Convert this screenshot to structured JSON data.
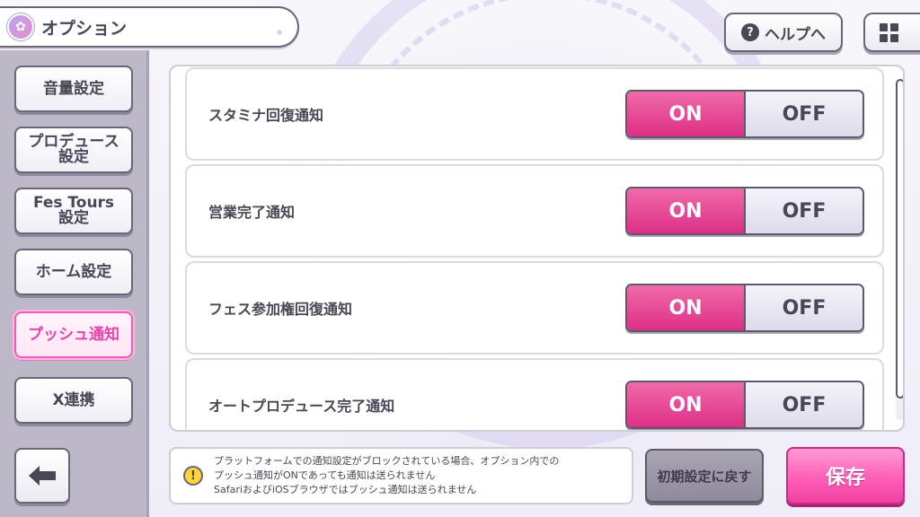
{
  "header": {
    "title": "オプション",
    "help_label": "ヘルプへ"
  },
  "sidebar": {
    "items": [
      {
        "label": "音量設定",
        "active": false
      },
      {
        "label": "プロデュース\n設定",
        "active": false
      },
      {
        "label": "Fes Tours\n設定",
        "active": false
      },
      {
        "label": "ホーム設定",
        "active": false
      },
      {
        "label": "プッシュ通知",
        "active": true
      },
      {
        "label": "X連携",
        "active": false
      }
    ]
  },
  "settings": [
    {
      "label": "スタミナ回復通知",
      "on": "ON",
      "off": "OFF",
      "value": "ON"
    },
    {
      "label": "営業完了通知",
      "on": "ON",
      "off": "OFF",
      "value": "ON"
    },
    {
      "label": "フェス参加権回復通知",
      "on": "ON",
      "off": "OFF",
      "value": "ON"
    },
    {
      "label": "オートプロデュース完了通知",
      "on": "ON",
      "off": "OFF",
      "value": "ON"
    }
  ],
  "notice": {
    "lines": [
      "プラットフォームでの通知設定がブロックされている場合、オプション内での",
      "プッシュ通知がONであっても通知は送られません",
      "SafariおよびiOSブラウザではプッシュ通知は送られません"
    ]
  },
  "actions": {
    "reset_label": "初期設定に戻す",
    "save_label": "保存"
  },
  "colors": {
    "accent_pink": "#ef3fae",
    "toggle_on": "#dd2f86",
    "sidebar_bg": "#bcb8c8"
  }
}
